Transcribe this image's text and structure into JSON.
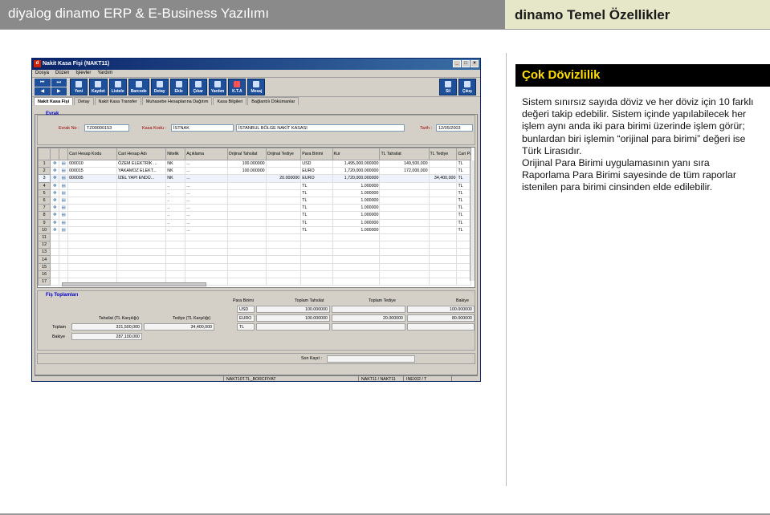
{
  "header": {
    "left_title": "diyalog dinamo ERP & E-Business Yazılımı",
    "right_title": "dinamo Temel Özellikler"
  },
  "section": {
    "title": "Çok Dövizlilik",
    "paragraph1": "Sistem sınırsız sayıda döviz ve her döviz için 10 farklı değeri takip edebilir. Sistem içinde yapılabilecek her işlem aynı anda iki para birimi üzerinde işlem görür; bunlardan biri işlemin “orijinal para birimi” değeri ise Türk Lirasıdır.",
    "paragraph2": "Orijinal Para Birimi uygulamasının yanı sıra Raporlama Para Birimi sayesinde de tüm raporlar istenilen para birimi cinsinden elde edilebilir."
  },
  "window": {
    "title": "Nakit Kasa Fişi (NAKT11)",
    "logo": "d",
    "controls": [
      "_",
      "□",
      "×"
    ],
    "menu": [
      "Dosya",
      "Düzen",
      "İşlevler",
      "Yardım"
    ],
    "nav": [
      "⏮",
      "⏭",
      "◀",
      "▶"
    ],
    "toolbar": [
      "Yeni",
      "Kaydet",
      "Listele",
      "Barcode",
      "Detay",
      "Ekle",
      "Çıkar",
      "Yardım",
      "K.T.A",
      "Mesaj"
    ],
    "toolbar_right": [
      "Sil",
      "Çıkış"
    ],
    "tabs": [
      "Nakit Kasa Fişi",
      "Detay",
      "Nakit Kasa Transfer",
      "Muhasebe Hesaplarına Dağıtım",
      "Kasa Bilgileri",
      "Bağlantılı Dökümanlar"
    ],
    "evrak": {
      "group": "Evrak",
      "evrak_no_label": "Evrak No :",
      "evrak_no": "TZ00000153",
      "kasa_kodu_label": "Kasa Kodu :",
      "kasa_kodu": "İSTNAK",
      "kasa_adi": "İSTANBUL BÖLGE NAKİT KASASI",
      "tarih_label": "Tarih :",
      "tarih": "12/05/2003"
    },
    "grid": {
      "columns": [
        "",
        "",
        "",
        "Cari Hesap Kodu",
        "Cari Hesap Adı",
        "Nitelik",
        "Açıklama",
        "Orijinal Tahsilat",
        "Orijinal Tediye",
        "Para Birimi",
        "Kur",
        "TL Tahsilat",
        "TL Tediye",
        "Cari Par"
      ],
      "rows": [
        {
          "n": "1",
          "code": "000010",
          "name": "ÖZEM ELEKTRİK ...",
          "nit": "NK",
          "acik": "...",
          "otah": "100.000000",
          "oted": "",
          "pb": "USD",
          "kur": "1,495,000.000000",
          "tltah": "149,500,000",
          "tlted": "",
          "cp": "TL"
        },
        {
          "n": "2",
          "code": "000015",
          "name": "YAKAMOZ ELEKT...",
          "nit": "NK",
          "acik": "...",
          "otah": "100.000000",
          "oted": "",
          "pb": "EURO",
          "kur": "1,720,000.000000",
          "tltah": "172,000,000",
          "tlted": "",
          "cp": "TL"
        },
        {
          "n": "3",
          "code": "000005",
          "name": "İZEL YAPI ENDÜ...",
          "nit": "NK",
          "acik": "...",
          "otah": "",
          "oted": "20.000000",
          "pb": "EURO",
          "kur": "1,720,000.000000",
          "tltah": "",
          "tlted": "34,400,000",
          "cp": "TL"
        },
        {
          "n": "4",
          "code": "",
          "name": "",
          "nit": "..",
          "acik": "...",
          "otah": "",
          "oted": "",
          "pb": "TL",
          "kur": "1.000000",
          "tltah": "",
          "tlted": "",
          "cp": "TL"
        },
        {
          "n": "5",
          "code": "",
          "name": "",
          "nit": "..",
          "acik": "...",
          "otah": "",
          "oted": "",
          "pb": "TL",
          "kur": "1.000000",
          "tltah": "",
          "tlted": "",
          "cp": "TL"
        },
        {
          "n": "6",
          "code": "",
          "name": "",
          "nit": "..",
          "acik": "...",
          "otah": "",
          "oted": "",
          "pb": "TL",
          "kur": "1.000000",
          "tltah": "",
          "tlted": "",
          "cp": "TL"
        },
        {
          "n": "7",
          "code": "",
          "name": "",
          "nit": "..",
          "acik": "...",
          "otah": "",
          "oted": "",
          "pb": "TL",
          "kur": "1.000000",
          "tltah": "",
          "tlted": "",
          "cp": "TL"
        },
        {
          "n": "8",
          "code": "",
          "name": "",
          "nit": "..",
          "acik": "...",
          "otah": "",
          "oted": "",
          "pb": "TL",
          "kur": "1.000000",
          "tltah": "",
          "tlted": "",
          "cp": "TL"
        },
        {
          "n": "9",
          "code": "",
          "name": "",
          "nit": "..",
          "acik": "...",
          "otah": "",
          "oted": "",
          "pb": "TL",
          "kur": "1.000000",
          "tltah": "",
          "tlted": "",
          "cp": "TL"
        },
        {
          "n": "10",
          "code": "",
          "name": "",
          "nit": "..",
          "acik": "...",
          "otah": "",
          "oted": "",
          "pb": "TL",
          "kur": "1.000000",
          "tltah": "",
          "tlted": "",
          "cp": "TL"
        }
      ],
      "empty_rows": [
        "11",
        "12",
        "13",
        "14",
        "15",
        "16",
        "17"
      ]
    },
    "totals": {
      "group": "Fiş Toplamları",
      "headers": [
        "Para Birimi",
        "Toplam Tahsilat",
        "Toplam Tediye",
        "Bakiye"
      ],
      "rows": [
        {
          "pb": "USD",
          "tah": "100.000000",
          "ted": "",
          "bak": "100.000000"
        },
        {
          "pb": "EURO",
          "tah": "100.000000",
          "ted": "20.000000",
          "bak": "80.000000"
        },
        {
          "pb": "TL",
          "tah": "",
          "ted": "",
          "bak": ""
        }
      ],
      "tah_label": "Tahsilat (TL Karşılığı)",
      "ted_label": "Tediye (TL Karşılığı)",
      "toplam_label": "Toplam",
      "toplam_tah": "321,500,000",
      "toplam_ted": "34,400,000",
      "bakiye_label": "Bakiye",
      "bakiye": "287,100,000"
    },
    "son_kayit_label": "Son Kayıt :",
    "status": [
      "",
      "NAKT10T.TL_BORCFIYAT",
      "NAKT11 / NAKT11",
      "INEX02 / T"
    ]
  }
}
